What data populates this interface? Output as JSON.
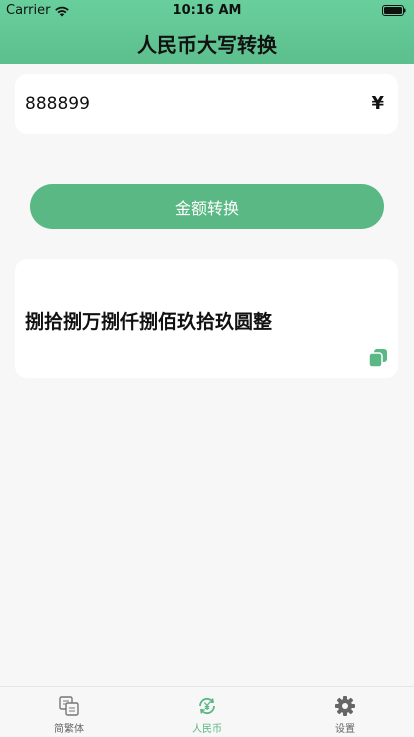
{
  "status_bar": {
    "carrier": "Carrier",
    "time": "10:16 AM"
  },
  "header": {
    "title": "人民币大写转换"
  },
  "amount": {
    "value": "888899",
    "currency_symbol": "¥"
  },
  "convert_button": {
    "label": "金额转换"
  },
  "result": {
    "text": "捌拾捌万捌仟捌佰玖拾玖圆整"
  },
  "tabs": [
    {
      "label": "简繁体",
      "icon": "traditional-simplified-icon",
      "active": false
    },
    {
      "label": "人民币",
      "icon": "rmb-convert-icon",
      "active": true
    },
    {
      "label": "设置",
      "icon": "gear-icon",
      "active": false
    }
  ],
  "colors": {
    "accent": "#59b883",
    "header": "#62c695",
    "background": "#f7f7f7"
  }
}
